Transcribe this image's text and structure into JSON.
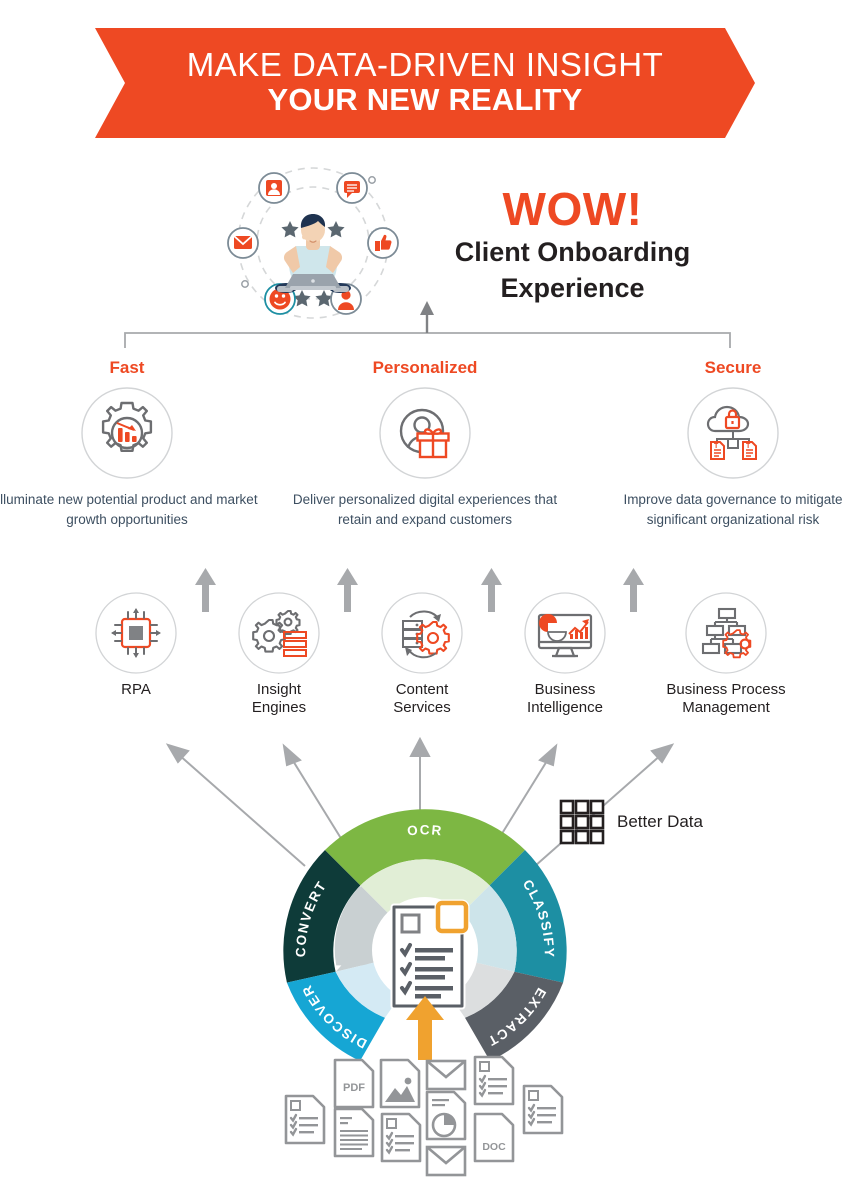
{
  "banner": {
    "line1": "MAKE DATA-DRIVEN INSIGHT",
    "line2": "YOUR NEW REALITY",
    "background_color": "#EE4923",
    "text_color": "#FFFFFF"
  },
  "hero": {
    "headline_accent": "WOW!",
    "headline_line1": "Client Onboarding",
    "headline_line2": "Experience",
    "accent_color": "#EE4923",
    "headline_color": "#231F20",
    "illustration": "person-sitting-with-laptop",
    "orbit_icons": [
      "user-card-icon",
      "chat-bubble-icon",
      "thumbs-up-icon",
      "avatar-icon",
      "smiley-icon",
      "mail-icon"
    ],
    "star_count_top": 3,
    "star_count_bottom": 2
  },
  "pillars": [
    {
      "title": "Fast",
      "icon": "gear-with-bar-chart-icon",
      "description": "Illuminate new potential product and market growth opportunities"
    },
    {
      "title": "Personalized",
      "icon": "person-with-gift-icon",
      "description": "Deliver personalized digital experiences that retain and expand customers"
    },
    {
      "title": "Secure",
      "icon": "cloud-lock-documents-icon",
      "description": "Improve data governance to mitigate significant organizational risk"
    }
  ],
  "technologies": [
    {
      "label_line1": "RPA",
      "label_line2": "",
      "icon": "microchip-icon"
    },
    {
      "label_line1": "Insight",
      "label_line2": "Engines",
      "icon": "gears-with-list-icon"
    },
    {
      "label_line1": "Content",
      "label_line2": "Services",
      "icon": "server-gear-sync-icon"
    },
    {
      "label_line1": "Business",
      "label_line2": "Intelligence",
      "icon": "monitor-charts-icon"
    },
    {
      "label_line1": "Business Process",
      "label_line2": "Management",
      "icon": "flowchart-gear-icon"
    }
  ],
  "better_data": {
    "label": "Better Data",
    "icon": "grid-3x3-icon"
  },
  "wheel": {
    "center_icon": "checklist-document-icon",
    "input_arrow_color": "#F0A22F",
    "segments": [
      {
        "label": "CONVERT",
        "color": "#0E3B39",
        "inner_color": "#C9D0D2"
      },
      {
        "label": "OCR",
        "color": "#7DB743",
        "inner_color": "#E1EED6"
      },
      {
        "label": "CLASSIFY",
        "color": "#1D8FA3",
        "inner_color": "#CDE4EA"
      },
      {
        "label": "EXTRACT",
        "color": "#5A5F66",
        "inner_color": "#DCDEDF"
      },
      {
        "label": "DISCOVER",
        "color": "#16A6D4",
        "inner_color": "#D4EAF4"
      }
    ]
  },
  "documents": [
    {
      "type": "checklist-document-icon",
      "label": ""
    },
    {
      "type": "pdf-document-icon",
      "label": "PDF"
    },
    {
      "type": "image-document-icon",
      "label": ""
    },
    {
      "type": "envelope-icon",
      "label": ""
    },
    {
      "type": "checklist-document-icon",
      "label": ""
    },
    {
      "type": "lined-document-icon",
      "label": ""
    },
    {
      "type": "checklist-document-icon",
      "label": ""
    },
    {
      "type": "pie-chart-document-icon",
      "label": ""
    },
    {
      "type": "doc-document-icon",
      "label": "DOC"
    },
    {
      "type": "checklist-document-icon",
      "label": ""
    },
    {
      "type": "envelope-icon",
      "label": ""
    }
  ],
  "colors": {
    "accent_orange": "#EE4923",
    "body_text": "#3D4F61",
    "heading_dark": "#231F20",
    "line_gray": "#A7A9AC",
    "icon_gray": "#6D6E71"
  }
}
